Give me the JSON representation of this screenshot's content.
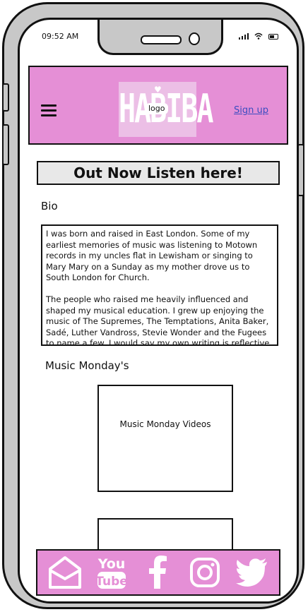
{
  "status_bar": {
    "time": "09:52 AM"
  },
  "header": {
    "logo_word": "HABIBA",
    "logo_label": "logo",
    "signup_label": "Sign up"
  },
  "banner": {
    "text": "Out Now Listen here!"
  },
  "bio": {
    "heading": "Bio",
    "paragraphs": [
      "I was born and raised in East London. Some of my earliest memories of music was listening to Motown records in my uncles flat in Lewisham or singing to Mary Mary on a Sunday as my mother drove us to South London for Church.",
      "The people who raised me heavily influenced and shaped my musical education. I grew up enjoying the music of The Supremes, The Temptations, Anita Baker, Sadé, Luther Vandross, Stevie Wonder and the Fugees to name a few. I would say my own writing is reflective"
    ]
  },
  "music": {
    "heading": "Music Monday's",
    "video_label": "Music Monday Videos"
  },
  "footer": {
    "icons": [
      "mail-icon",
      "youtube-icon",
      "facebook-icon",
      "instagram-icon",
      "twitter-icon"
    ]
  },
  "colors": {
    "accent": "#e58fd6",
    "banner_bg": "#e8e8e8",
    "link": "#3b4cc0"
  }
}
